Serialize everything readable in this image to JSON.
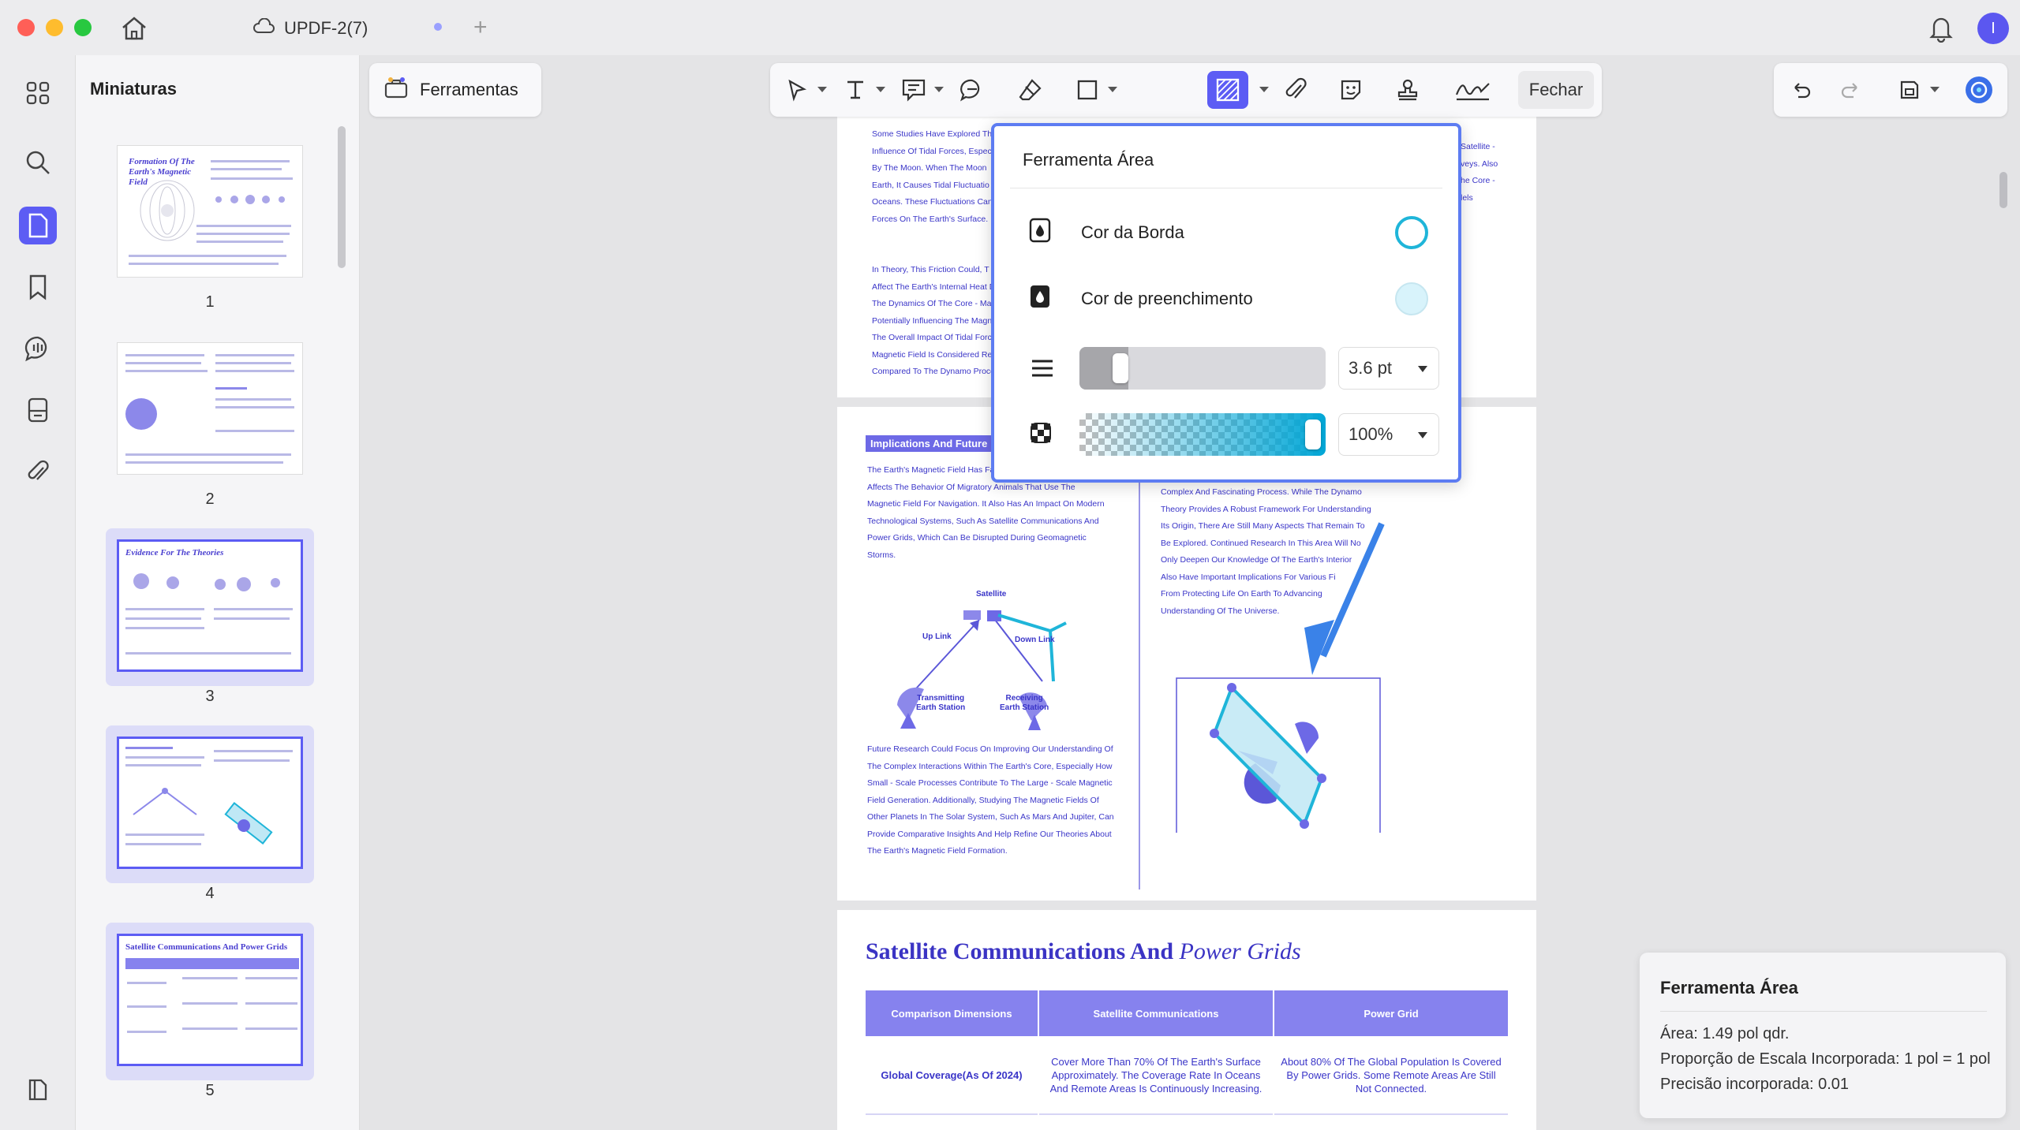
{
  "window": {
    "doc_title": "UPDF-2(7)",
    "avatar_letter": "I",
    "close_label": "Fechar"
  },
  "sidebar": {
    "title": "Miniaturas",
    "tools_label": "Ferramentas",
    "thumbnails": [
      {
        "num": "1",
        "title": "Formation Of The Earth's Magnetic Field"
      },
      {
        "num": "2",
        "title": ""
      },
      {
        "num": "3",
        "title": "Evidence For The Theories"
      },
      {
        "num": "4",
        "title": ""
      },
      {
        "num": "5",
        "title": "Satellite Communications And Power Grids"
      }
    ]
  },
  "popup": {
    "title": "Ferramenta Área",
    "border_color_label": "Cor da Borda",
    "fill_color_label": "Cor de preenchimento",
    "stroke_width": "3.6 pt",
    "opacity": "100%",
    "stroke_level": 0.13,
    "opacity_level": 1.0,
    "border_color": "#1fb5d9",
    "fill_color": "#d8f3fb"
  },
  "page_a": {
    "left_text": "Some Studies Have Explored The\nInfluence Of Tidal Forces, Especi\nBy The Moon. When The Moon\nEarth, It Causes Tidal Fluctuatio\nOceans. These Fluctuations Can C\nForces On The Earth's Surface.\n\n\nIn Theory, This Friction Could, T\nAffect The Earth's Internal Heat D\nThe Dynamics Of The Core - Man\nPotentially Influencing The Magne\nThe Overall Impact Of Tidal Force\nMagnetic Field Is Considered Rel\nCompared To The Dynamo Proce",
    "right_text": "Satellite -\nveys. Also\nhe Core -\nlels"
  },
  "page_b": {
    "section_tag": "Implications And Future",
    "left_para": "The Earth's Magnetic Field Has Far\nAffects The Behavior Of Migratory Animals That Use The\nMagnetic Field For Navigation. It Also Has An Impact On Modern\nTechnological Systems, Such As Satellite Communications And\nPower Grids, Which Can Be Disrupted During Geomagnetic\nStorms.",
    "right_para": "Complex And Fascinating Process. While The Dynamo\nTheory Provides A Robust Framework For Understanding\nIts Origin, There Are Still Many Aspects That Remain To\nBe Explored. Continued Research In This Area Will No\nOnly Deepen Our Knowledge Of The Earth's Interior\nAlso Have Important Implications For Various Fi\nFrom Protecting Life On Earth To Advancing\nUnderstanding Of The Universe.",
    "diagram_labels": {
      "satellite": "Satellite",
      "up_link": "Up Link",
      "down_link": "Down Link",
      "transmitting": "Transmitting\nEarth Station",
      "receiving": "Receiving\nEarth Station"
    },
    "bottom_para": "Future Research Could Focus On Improving Our Understanding Of\nThe Complex Interactions Within The Earth's Core, Especially How\nSmall - Scale Processes Contribute To The Large - Scale Magnetic\nField Generation. Additionally, Studying The Magnetic Fields Of\nOther Planets In The Solar System, Such As Mars And Jupiter, Can\nProvide Comparative Insights And Help Refine Our Theories About\nThe Earth's Magnetic Field Formation."
  },
  "page_c": {
    "title_main": "Satellite Communications And ",
    "title_italic": "Power Grids",
    "headers": [
      "Comparison Dimensions",
      "Satellite Communications",
      "Power Grid"
    ],
    "row1": [
      "Global Coverage(As Of 2024)",
      "Cover More Than 70% Of The Earth's Surface\nApproximately. The Coverage Rate In Oceans\nAnd Remote Areas Is Continuously Increasing.",
      "About 80% Of The Global Population Is Covered\nBy Power Grids. Some Remote Areas Are Still\nNot Connected."
    ]
  },
  "info_panel": {
    "title": "Ferramenta Área",
    "area": "Área: 1.49  pol qdr.",
    "scale": "Proporção de Escala Incorporada: 1 pol = 1 pol",
    "precision": "Precisão incorporada: 0.01"
  },
  "colors": {
    "accent": "#5c5cf4",
    "doc_blue": "#3b34c4",
    "annotation_cyan": "#1fb5d9"
  }
}
